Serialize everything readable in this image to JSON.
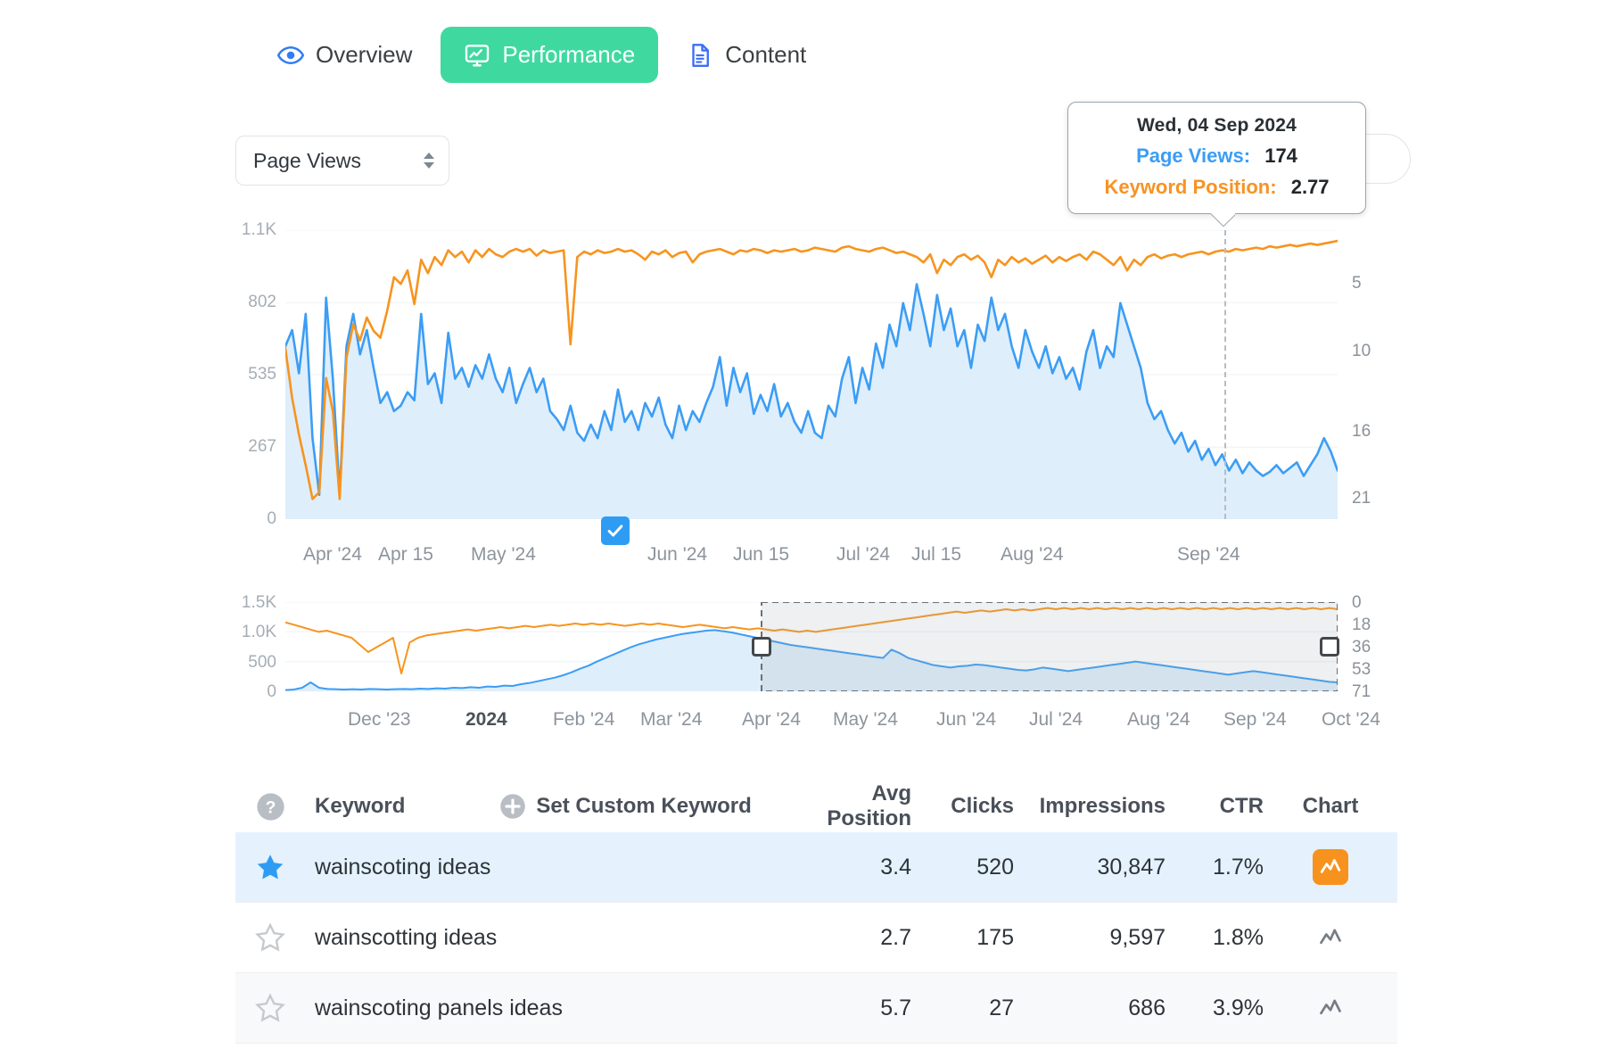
{
  "tabs": [
    {
      "label": "Overview",
      "icon": "eye-icon",
      "active": false
    },
    {
      "label": "Performance",
      "icon": "monitor-chart-icon",
      "active": true
    },
    {
      "label": "Content",
      "icon": "document-icon",
      "active": false
    }
  ],
  "controls": {
    "metric_select_value": "Page Views"
  },
  "tooltip": {
    "date": "Wed, 04 Sep 2024",
    "rows": [
      {
        "label": "Page Views:",
        "value": "174",
        "color": "#3b9df5"
      },
      {
        "label": "Keyword Position:",
        "value": "2.77",
        "color": "#f79323"
      }
    ]
  },
  "colors": {
    "page_views": "#3b9df5",
    "keyword_position": "#f7941e",
    "accent_green": "#3fd9a0",
    "selected_row": "#e5f2fd"
  },
  "table": {
    "headers": {
      "help": "?",
      "keyword": "Keyword",
      "set_custom": "Set Custom Keyword",
      "avg_position": "Avg Position",
      "clicks": "Clicks",
      "impressions": "Impressions",
      "ctr": "CTR",
      "chart": "Chart"
    },
    "rows": [
      {
        "starred": true,
        "keyword": "wainscoting ideas",
        "avg_position": "3.4",
        "clicks": "520",
        "impressions": "30,847",
        "ctr": "1.7%",
        "chart_active": true
      },
      {
        "starred": false,
        "keyword": "wainscotting ideas",
        "avg_position": "2.7",
        "clicks": "175",
        "impressions": "9,597",
        "ctr": "1.8%",
        "chart_active": false
      },
      {
        "starred": false,
        "keyword": "wainscoting panels ideas",
        "avg_position": "5.7",
        "clicks": "27",
        "impressions": "686",
        "ctr": "3.9%",
        "chart_active": false
      }
    ]
  },
  "chart_data": {
    "type": "line",
    "title": "",
    "xlabel": "",
    "ylabel": "Page Views",
    "y2label": "Keyword Position",
    "grid": true,
    "legend": "none",
    "main": {
      "yleft_ticks": [
        "1.1K",
        "802",
        "535",
        "267",
        "0"
      ],
      "yleft_values": [
        1070,
        802,
        535,
        267,
        0
      ],
      "yright_ticks": [
        "5",
        "10",
        "16",
        "21"
      ],
      "yright_values": [
        5,
        10,
        16,
        21
      ],
      "xticks": [
        "Apr '24",
        "Apr 15",
        "May '24",
        "Jun '24",
        "Jun 15",
        "Jul '24",
        "Jul 15",
        "Aug '24",
        "Sep '24"
      ],
      "series": [
        {
          "name": "Page Views",
          "color": "#3b9df5",
          "fill": true,
          "values": [
            640,
            700,
            540,
            760,
            300,
            90,
            820,
            520,
            95,
            640,
            760,
            610,
            700,
            560,
            430,
            470,
            400,
            420,
            470,
            440,
            760,
            500,
            540,
            430,
            690,
            520,
            560,
            490,
            570,
            520,
            610,
            520,
            470,
            560,
            430,
            500,
            560,
            470,
            520,
            400,
            370,
            330,
            420,
            320,
            290,
            350,
            300,
            400,
            330,
            480,
            360,
            400,
            330,
            430,
            380,
            450,
            350,
            300,
            420,
            330,
            400,
            360,
            430,
            490,
            600,
            420,
            560,
            470,
            540,
            390,
            460,
            400,
            500,
            380,
            430,
            360,
            320,
            400,
            320,
            300,
            420,
            380,
            520,
            600,
            430,
            560,
            480,
            650,
            560,
            720,
            640,
            800,
            700,
            870,
            760,
            640,
            830,
            700,
            780,
            640,
            700,
            560,
            720,
            660,
            820,
            700,
            760,
            640,
            560,
            700,
            620,
            560,
            640,
            540,
            600,
            520,
            560,
            480,
            620,
            700,
            560,
            640,
            600,
            800,
            720,
            640,
            560,
            430,
            370,
            400,
            330,
            280,
            320,
            250,
            290,
            220,
            260,
            200,
            240,
            180,
            220,
            170,
            210,
            180,
            160,
            175,
            200,
            170,
            190,
            210,
            160,
            200,
            240,
            300,
            250,
            180
          ]
        },
        {
          "name": "Keyword Position",
          "color": "#f7941e",
          "fill": false,
          "values": [
            9.8,
            13.5,
            16.2,
            18.5,
            21,
            20.5,
            12.0,
            14.5,
            21,
            10.5,
            8.0,
            9.2,
            7.5,
            8.5,
            9.0,
            7.0,
            4.5,
            5.0,
            4.0,
            6.5,
            3.2,
            4.2,
            3.0,
            3.6,
            2.5,
            3.0,
            2.6,
            3.4,
            2.5,
            3.0,
            2.4,
            2.8,
            3.0,
            2.6,
            2.4,
            2.6,
            2.4,
            2.9,
            2.5,
            2.7,
            2.6,
            2.5,
            9.5,
            3.0,
            2.6,
            2.8,
            2.5,
            2.7,
            2.6,
            2.4,
            2.6,
            2.5,
            2.8,
            3.2,
            2.6,
            2.8,
            2.5,
            3.0,
            2.7,
            2.6,
            3.4,
            2.8,
            2.6,
            2.5,
            2.4,
            2.6,
            2.8,
            2.5,
            2.6,
            2.4,
            2.5,
            2.7,
            2.5,
            2.6,
            2.5,
            2.4,
            2.6,
            2.5,
            2.3,
            2.4,
            2.5,
            2.6,
            2.3,
            2.2,
            2.4,
            2.5,
            2.6,
            2.4,
            2.3,
            2.5,
            2.7,
            2.6,
            2.8,
            3.0,
            3.4,
            2.8,
            4.2,
            3.2,
            3.6,
            3.0,
            2.8,
            3.2,
            2.9,
            3.4,
            4.5,
            3.2,
            3.6,
            3.0,
            3.4,
            3.1,
            3.5,
            3.2,
            2.9,
            3.4,
            3.0,
            3.3,
            3.0,
            2.8,
            3.2,
            2.6,
            2.8,
            3.2,
            3.6,
            3.0,
            4.0,
            3.2,
            3.6,
            3.0,
            2.8,
            3.1,
            2.9,
            2.8,
            3.0,
            2.8,
            2.7,
            2.6,
            2.8,
            2.6,
            2.5,
            2.6,
            2.4,
            2.5,
            2.4,
            2.3,
            2.4,
            2.2,
            2.3,
            2.2,
            2.1,
            2.2,
            2.1,
            2.0,
            2.1,
            2.0,
            1.9,
            1.8
          ]
        }
      ],
      "tooltip_marker": {
        "date": "Wed, 04 Sep 2024",
        "page_views": 174,
        "keyword_position": 2.77
      }
    },
    "navigator": {
      "yleft_ticks": [
        "1.5K",
        "1.0K",
        "500",
        "0"
      ],
      "yleft_values": [
        1500,
        1000,
        500,
        0
      ],
      "yright_ticks": [
        "0",
        "18",
        "36",
        "53",
        "71"
      ],
      "yright_values": [
        0,
        18,
        36,
        53,
        71
      ],
      "xticks": [
        "Dec '23",
        "2024",
        "Feb '24",
        "Mar '24",
        "Apr '24",
        "May '24",
        "Jun '24",
        "Jul '24",
        "Aug '24",
        "Sep '24",
        "Oct '24"
      ],
      "selection": {
        "start": "Apr '24",
        "end": "Oct '24"
      },
      "series": [
        {
          "name": "Page Views",
          "color": "#3b9df5",
          "values": [
            20,
            30,
            60,
            150,
            60,
            40,
            35,
            30,
            35,
            30,
            40,
            35,
            30,
            35,
            40,
            35,
            45,
            40,
            50,
            45,
            60,
            55,
            70,
            60,
            80,
            75,
            95,
            90,
            120,
            140,
            170,
            200,
            230,
            270,
            320,
            380,
            430,
            500,
            560,
            620,
            680,
            740,
            790,
            830,
            870,
            900,
            930,
            960,
            980,
            1000,
            1020,
            1030,
            1010,
            990,
            960,
            930,
            900,
            870,
            840,
            810,
            780,
            760,
            740,
            720,
            700,
            680,
            660,
            640,
            620,
            600,
            580,
            560,
            700,
            640,
            560,
            520,
            480,
            440,
            420,
            400,
            420,
            430,
            450,
            440,
            420,
            400,
            380,
            360,
            350,
            370,
            400,
            380,
            360,
            340,
            360,
            380,
            400,
            420,
            440,
            460,
            480,
            500,
            480,
            460,
            440,
            420,
            400,
            380,
            360,
            340,
            320,
            300,
            280,
            300,
            320,
            340,
            320,
            300,
            280,
            260,
            240,
            220,
            200,
            180,
            160,
            150
          ]
        },
        {
          "name": "Keyword Position",
          "color": "#f7941e",
          "values": [
            17,
            19,
            21,
            23,
            25,
            24,
            26,
            28,
            30,
            36,
            42,
            38,
            34,
            30,
            60,
            34,
            30,
            28,
            27,
            26,
            25,
            24,
            23,
            24,
            23,
            22,
            21,
            22,
            21,
            20,
            21,
            20,
            19,
            20,
            19,
            18,
            19,
            18,
            19,
            18,
            19,
            20,
            19,
            18,
            19,
            18,
            19,
            20,
            21,
            20,
            19,
            20,
            21,
            22,
            21,
            22,
            23,
            22,
            23,
            24,
            23,
            24,
            25,
            24,
            25,
            24,
            23,
            22,
            21,
            20,
            19,
            18,
            17,
            16,
            15,
            14,
            13,
            12,
            11,
            10,
            9,
            8,
            9,
            8,
            7,
            8,
            7,
            6,
            7,
            6,
            7,
            6,
            5,
            6,
            5,
            6,
            5,
            6,
            5,
            6,
            5,
            6,
            5,
            6,
            5,
            6,
            5,
            6,
            5,
            6,
            5,
            6,
            5,
            6,
            5,
            6,
            5,
            6,
            5,
            6,
            5,
            6,
            5,
            6,
            5,
            6,
            5,
            6
          ]
        }
      ]
    }
  }
}
